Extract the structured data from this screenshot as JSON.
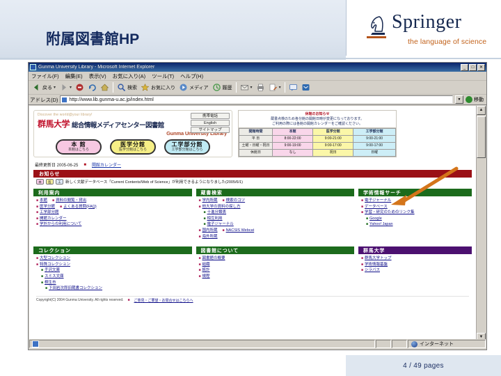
{
  "slide": {
    "title": "附属図書館HP",
    "page_label": "4 / 49 pages",
    "brand": {
      "name": "Springer",
      "tagline": "the language of science",
      "accent_color": "#c2621b",
      "word_color": "#16284f"
    }
  },
  "browser": {
    "window_title": "Gunma University Library - Microsoft Internet Explorer",
    "window_buttons": [
      "_",
      "□",
      "✕"
    ],
    "menus": [
      "ファイル(F)",
      "編集(E)",
      "表示(V)",
      "お気に入り(A)",
      "ツール(T)",
      "ヘルプ(H)"
    ],
    "toolbar": [
      {
        "label": "戻る",
        "icon": "back-arrow-icon",
        "color": "#2d6f2d",
        "caret": true
      },
      {
        "label": "",
        "icon": "forward-arrow-icon",
        "color": "#8a8a8a",
        "caret": true
      },
      {
        "label": "",
        "icon": "stop-icon",
        "color": "#b03030",
        "caret": false
      },
      {
        "label": "",
        "icon": "refresh-icon",
        "color": "#2e6ab0",
        "caret": false
      },
      {
        "label": "",
        "icon": "home-icon",
        "color": "#c8b058",
        "caret": false
      },
      {
        "label": "検索",
        "icon": "search-icon",
        "color": "#3a5fa8",
        "caret": false
      },
      {
        "label": "お気に入り",
        "icon": "favorites-star-icon",
        "color": "#d8b43a",
        "caret": false
      },
      {
        "label": "メディア",
        "icon": "media-icon",
        "color": "#5a8ac8",
        "caret": false
      },
      {
        "label": "履歴",
        "icon": "history-icon",
        "color": "#4f9b4f",
        "caret": false
      },
      {
        "label": "",
        "icon": "mail-icon",
        "color": "#d0cdc4",
        "caret": true
      },
      {
        "label": "",
        "icon": "print-icon",
        "color": "#6f6f6f",
        "caret": false
      },
      {
        "label": "",
        "icon": "edit-icon",
        "color": "#b85c2a",
        "caret": true
      },
      {
        "label": "",
        "icon": "discuss-icon",
        "color": "#4070b8",
        "caret": false
      },
      {
        "label": "",
        "icon": "messenger-icon",
        "color": "#2e6ab0",
        "caret": false
      }
    ],
    "address_label": "アドレス(D)",
    "address_value": "http://www.lib.gunma-u.ac.jp/index.html",
    "go_label": "移動",
    "status": {
      "page_text": "",
      "zone_text": "インターネット"
    }
  },
  "site": {
    "logo": {
      "tagline_en": "Discover the world@your library!",
      "university": "群馬大学",
      "center": "総合情報メディアセンター図書館",
      "english_name": "Gunma University Library",
      "side_buttons": [
        "携帯電話",
        "English",
        "サイトマップ"
      ]
    },
    "branches": [
      {
        "name": "本 館",
        "sub": "本館はこちら",
        "color": "#f7c8e2"
      },
      {
        "name": "医学分館",
        "sub": "医学分館はこちら",
        "color": "#f6ef86"
      },
      {
        "name": "工学部分館",
        "sub": "工学部分館はこちら",
        "color": "#bfeaf3"
      }
    ],
    "hours": {
      "notice_title": "休館のお知らせ",
      "notice_lines": [
        "蔵書点検のため各分館の開館日時が変更になっております。",
        "ご利用の際には各館の開館カレンダーをご確認ください。"
      ],
      "columns": [
        "開館時間",
        "本館",
        "医学分館",
        "工学部分館"
      ],
      "rows": [
        {
          "label": "平 日",
          "values": [
            "8:00-22:00",
            "9:00-21:00",
            "9:00-21:00"
          ]
        },
        {
          "label": "土曜・日曜・祝日",
          "values": [
            "9:00-19:00",
            "9:00-17:00",
            "9:00-17:00"
          ]
        },
        {
          "label": "休館日",
          "values": [
            "なし",
            "祝日",
            "日曜"
          ]
        }
      ]
    },
    "update": {
      "label": "最終更新日 2005-06-25",
      "link": "開館カレンダー"
    },
    "notice": {
      "header": "お知らせ",
      "badges": [
        "本",
        "医",
        "工"
      ],
      "text": "新しく文献データベース「Current Contents/Web of Science」が利用できるようになりました(2005/6/1)"
    },
    "sections": [
      {
        "id": "usage-guide",
        "title": "利用案内",
        "color": "green",
        "items": [
          {
            "label": "本館",
            "indent": 0,
            "link": false,
            "extra": "資料の閲覧・貸出"
          },
          {
            "label": "医学分館",
            "indent": 0,
            "link": false,
            "extra": "よくある質問(FAQ)"
          },
          {
            "label": "工学部分館",
            "indent": 0,
            "link": true
          },
          {
            "label": "開館カレンダー",
            "indent": 0,
            "link": true
          },
          {
            "label": "学外からの利用について",
            "indent": 0,
            "link": false
          }
        ]
      },
      {
        "id": "catalog-search",
        "title": "蔵書検索",
        "color": "green",
        "items": [
          {
            "label": "学内所蔵",
            "indent": 0,
            "link": false,
            "extra": "検索のコツ"
          },
          {
            "label": "他大学の資料の探し方",
            "indent": 0,
            "link": false
          },
          {
            "label": "十進分類表",
            "indent": 1,
            "link": false
          },
          {
            "label": "相互利用",
            "indent": 1,
            "link": false
          },
          {
            "label": "電子ジャーナル",
            "indent": 1,
            "link": true
          },
          {
            "label": "国内所蔵",
            "indent": 0,
            "link": false,
            "extra": "NACSIS Webcat"
          },
          {
            "label": "海外所蔵",
            "indent": 0,
            "link": true
          }
        ]
      },
      {
        "id": "academic-search",
        "title": "学術情報サーチ",
        "color": "green",
        "items": [
          {
            "label": "電子ジャーナル",
            "indent": 0,
            "link": false
          },
          {
            "label": "データベース",
            "indent": 0,
            "link": false
          },
          {
            "label": "学習・研究のためのリンク集",
            "indent": 0,
            "link": true
          },
          {
            "label": "Google",
            "indent": 1,
            "link": true
          },
          {
            "label": "Yahoo! Japan",
            "indent": 1,
            "link": true
          }
        ]
      },
      {
        "id": "collections",
        "title": "コレクション",
        "color": "green",
        "items": [
          {
            "label": "大型コレクション",
            "indent": 0,
            "link": false
          },
          {
            "label": "特殊コレクション",
            "indent": 0,
            "link": true
          },
          {
            "label": "手沢文庫",
            "indent": 1,
            "link": true
          },
          {
            "label": "スミス文庫",
            "indent": 1,
            "link": false
          },
          {
            "label": "桐生市",
            "indent": 1,
            "link": false
          },
          {
            "label": "下田岩次郎旧蔵書コレクション",
            "indent": 2,
            "link": false
          }
        ]
      },
      {
        "id": "about-library",
        "title": "図書館について",
        "color": "green",
        "items": [
          {
            "label": "図書館の概要",
            "indent": 0,
            "link": false
          },
          {
            "label": "組織",
            "indent": 0,
            "link": true
          },
          {
            "label": "統計",
            "indent": 0,
            "link": true
          },
          {
            "label": "規程",
            "indent": 0,
            "link": false
          }
        ]
      },
      {
        "id": "gunma-university",
        "title": "群馬大学",
        "color": "purple",
        "items": [
          {
            "label": "群馬大学トップ",
            "indent": 0,
            "link": false
          },
          {
            "label": "学術情報基盤",
            "indent": 0,
            "link": true
          },
          {
            "label": "シラバス",
            "indent": 0,
            "link": true
          }
        ]
      }
    ],
    "footer": {
      "copyright": "Copyright(C) 2004 Gunma University. All rights reserved.",
      "contact_marker": "■",
      "contact": "ご意見・ご要望・お問合せはこちらへ"
    }
  },
  "annotation": {
    "arrow_color": "#d4751a",
    "points_to": "電子ジャーナル"
  }
}
